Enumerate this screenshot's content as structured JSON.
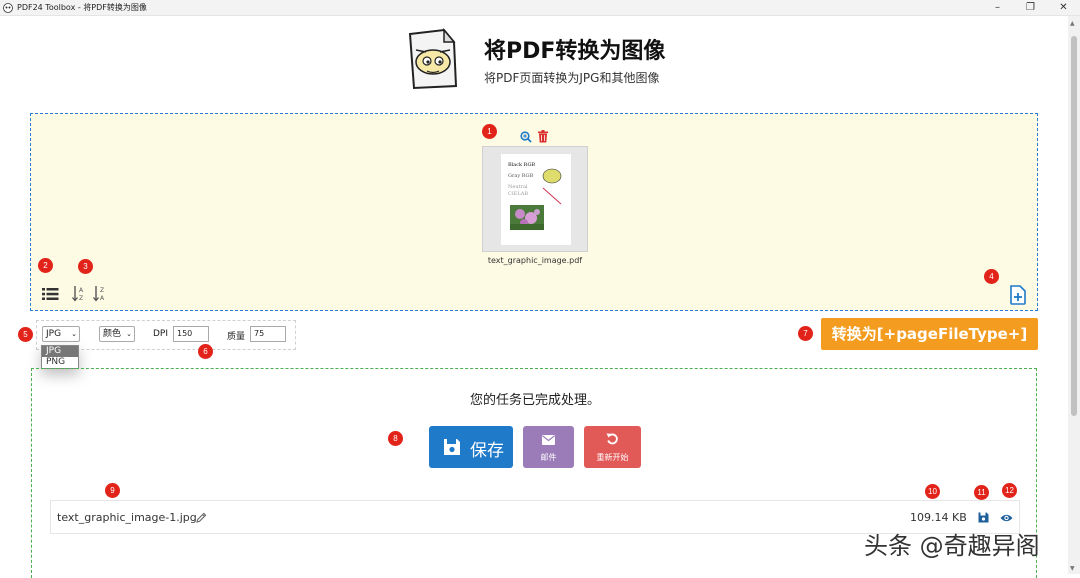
{
  "window": {
    "title": "PDF24 Toolbox - 将PDF转换为图像",
    "minimize": "–",
    "maximize": "❐",
    "close": "✕"
  },
  "header": {
    "title": "将PDF转换为图像",
    "subtitle": "将PDF页面转换为JPG和其他图像"
  },
  "badges": [
    "1",
    "2",
    "3",
    "4",
    "5",
    "6",
    "7",
    "8",
    "9",
    "10",
    "11",
    "12"
  ],
  "dropzone": {
    "file_name": "text_graphic_image.pdf",
    "thumbnail_text": [
      "Black RGB",
      "Gray RGB",
      "Neutral",
      "CIELAB"
    ]
  },
  "options": {
    "format_value": "JPG",
    "format_options": [
      "JPG",
      "PNG"
    ],
    "color_value": "颜色",
    "dpi_label": "DPI",
    "dpi_value": "150",
    "quality_label": "质量",
    "quality_value": "75"
  },
  "convert_button": "转换为[+pageFileType+]",
  "result": {
    "done_text": "您的任务已完成处理。",
    "save_label": "保存",
    "email_label": "邮件",
    "restart_label": "重新开始",
    "file_name": "text_graphic_image-1.jpg",
    "file_size": "109.14 KB"
  },
  "watermark": "头条 @奇趣异阁",
  "colors": {
    "accent_blue": "#1f7ac9",
    "convert_orange": "#f39c1f",
    "badge_red": "#e2231a",
    "email_purple": "#9b7bb8",
    "restart_red": "#e15a58",
    "dropzone_bg": "#fdfbe3"
  }
}
